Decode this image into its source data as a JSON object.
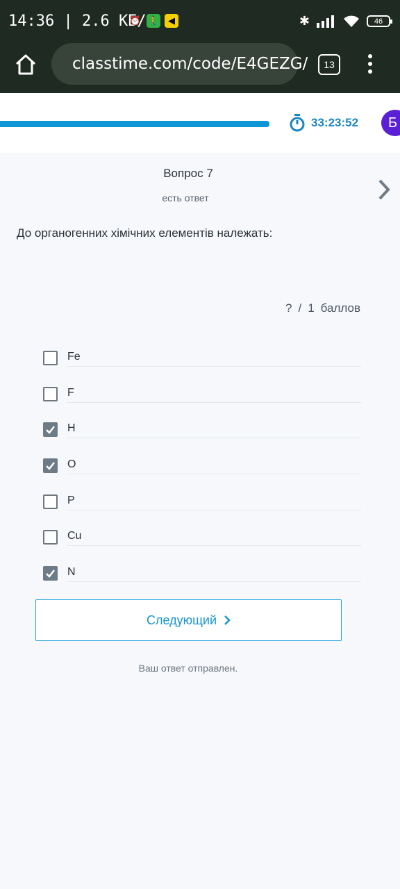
{
  "status_bar": {
    "time_speed": "14:36 | 2.6 КБ/с",
    "battery": "46"
  },
  "browser": {
    "url": "classtime.com/code/E4GEZG/",
    "tab_count": "13"
  },
  "header": {
    "progress_fraction": 0.67,
    "timer": "33:23:52",
    "avatar_letter": "Б"
  },
  "question": {
    "title": "Вопрос 7",
    "status": "есть ответ",
    "text": "До органогенних хімічних елементів належать:",
    "points": {
      "earned": "?",
      "separator": "/",
      "total": "1",
      "unit": "баллов"
    }
  },
  "options": [
    {
      "label": "Fe",
      "checked": false
    },
    {
      "label": "F",
      "checked": false
    },
    {
      "label": "H",
      "checked": true
    },
    {
      "label": "O",
      "checked": true
    },
    {
      "label": "P",
      "checked": false
    },
    {
      "label": "Cu",
      "checked": false
    },
    {
      "label": "N",
      "checked": true
    }
  ],
  "footer": {
    "next_label": "Следующий",
    "sent_note": "Ваш ответ отправлен."
  },
  "colors": {
    "accent": "#0f96d7",
    "avatar": "#5b1fd6",
    "checkbox_checked": "#6c7b86"
  }
}
